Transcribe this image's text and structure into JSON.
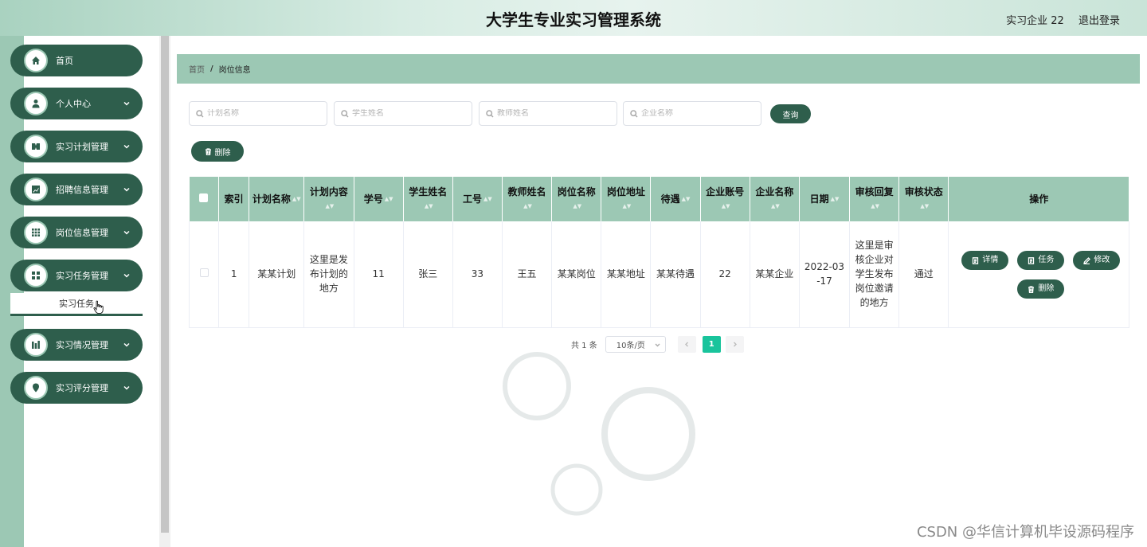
{
  "header": {
    "title": "大学生专业实习管理系统",
    "user": "实习企业 22",
    "logout": "退出登录"
  },
  "sidebar": {
    "items": [
      {
        "label": "首页",
        "icon": "home-icon",
        "expandable": false
      },
      {
        "label": "个人中心",
        "icon": "user-icon",
        "expandable": true
      },
      {
        "label": "实习计划管理",
        "icon": "plan-icon",
        "expandable": true
      },
      {
        "label": "招聘信息管理",
        "icon": "chart-icon",
        "expandable": true
      },
      {
        "label": "岗位信息管理",
        "icon": "grid-icon",
        "expandable": true
      },
      {
        "label": "实习任务管理",
        "icon": "apps-icon",
        "expandable": true
      },
      {
        "label": "实习情况管理",
        "icon": "bars-icon",
        "expandable": true
      },
      {
        "label": "实习评分管理",
        "icon": "pin-icon",
        "expandable": true
      }
    ],
    "submenu": {
      "label": "实习任务"
    }
  },
  "breadcrumb": {
    "home": "首页",
    "separator": "/",
    "current": "岗位信息"
  },
  "search": {
    "plan_name_placeholder": "计划名称",
    "student_name_placeholder": "学生姓名",
    "teacher_name_placeholder": "教师姓名",
    "company_name_placeholder": "企业名称",
    "query_button": "查询"
  },
  "toolbar": {
    "delete_button": "删除"
  },
  "table": {
    "headers": [
      "索引",
      "计划名称",
      "计划内容",
      "学号",
      "学生姓名",
      "工号",
      "教师姓名",
      "岗位名称",
      "岗位地址",
      "待遇",
      "企业账号",
      "企业名称",
      "日期",
      "审核回复",
      "审核状态",
      "操作"
    ],
    "rows": [
      {
        "index": "1",
        "plan_name": "某某计划",
        "plan_content": "这里是发布计划的地方",
        "student_no": "11",
        "student_name": "张三",
        "staff_no": "33",
        "teacher_name": "王五",
        "post_name": "某某岗位",
        "post_address": "某某地址",
        "salary": "某某待遇",
        "company_account": "22",
        "company_name": "某某企业",
        "date": "2022-03-17",
        "review_reply": "这里是审核企业对学生发布岗位邀请的地方",
        "review_status": "通过"
      }
    ],
    "actions": {
      "detail": "详情",
      "task": "任务",
      "edit": "修改",
      "delete": "删除"
    }
  },
  "pagination": {
    "total": "共 1 条",
    "page_size": "10条/页",
    "current_page": "1"
  },
  "watermark": "CSDN @华信计算机毕设源码程序",
  "colors": {
    "primary": "#2e5e4c",
    "accent_light": "#9cc8b4",
    "page_active": "#19c49c"
  }
}
